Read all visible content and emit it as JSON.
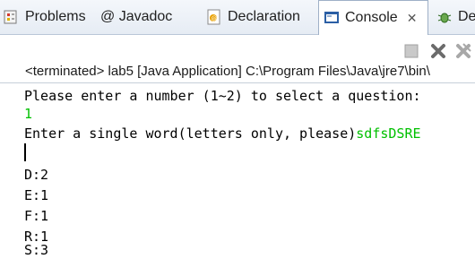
{
  "tabs": [
    {
      "label": "Problems",
      "icon": "problems-icon"
    },
    {
      "label": "@ Javadoc",
      "icon": "javadoc-icon"
    },
    {
      "label": "Declaration",
      "icon": "declaration-icon"
    },
    {
      "label": "Console",
      "icon": "console-icon",
      "active": true
    },
    {
      "label": "De",
      "icon": "debug-icon"
    }
  ],
  "toolbar": {
    "terminate_icon": "terminate-icon",
    "remove_launch_icon": "remove-launch-icon",
    "remove_all_icon": "remove-all-terminated-icon"
  },
  "status_line": "<terminated> lab5 [Java Application] C:\\Program Files\\Java\\jre7\\bin\\",
  "console": {
    "prompt1": "Please enter a number (1~2) to select a question:",
    "input1": "1",
    "prompt2": "Enter a single word(letters only, please)",
    "input2": "sdfsDSRE",
    "results": [
      "D:2",
      "E:1",
      "F:1",
      "R:1",
      "S:3"
    ]
  },
  "colors": {
    "input_text": "#00c000",
    "tab_bar": "#e6ecf4",
    "active_tab": "#ffffff"
  }
}
